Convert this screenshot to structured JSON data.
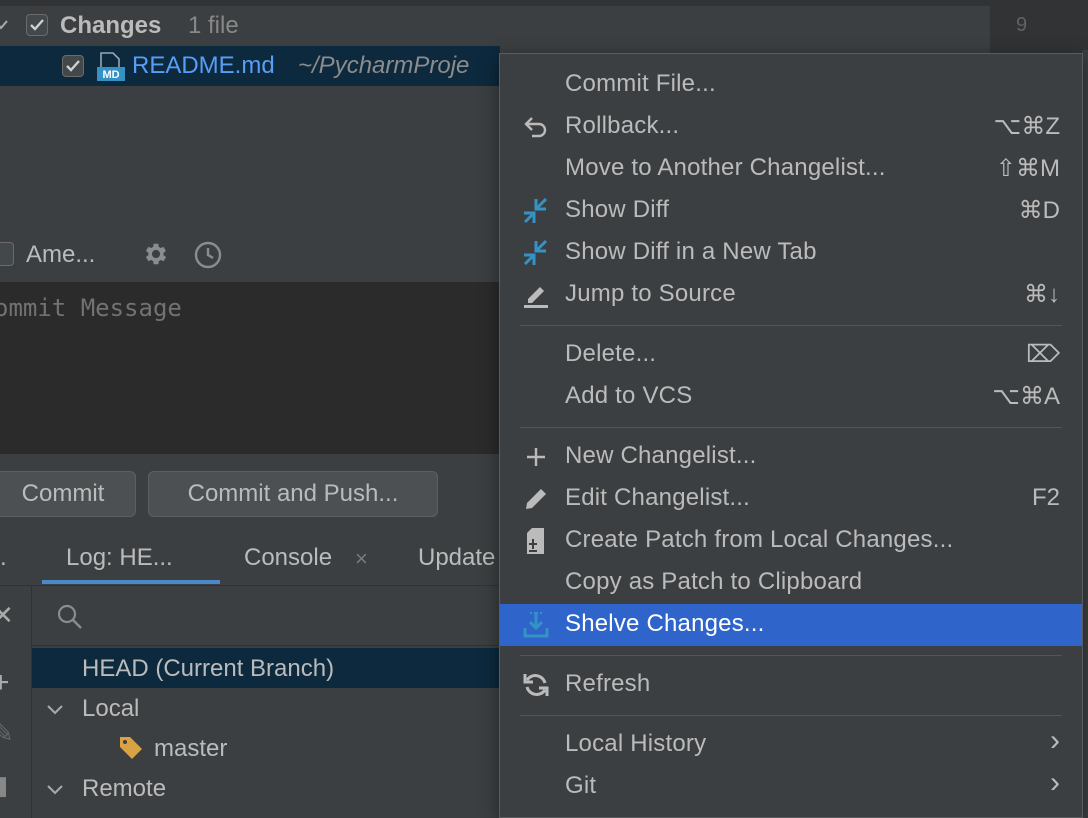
{
  "gutter": {
    "line_number": "9"
  },
  "changes_tree": {
    "group_label": "Changes",
    "group_count": "1 file",
    "file": {
      "name": "README.md",
      "path": "~/PycharmProje",
      "type_badge": "MD"
    }
  },
  "commit_panel": {
    "amend_label": "Ame...",
    "message_placeholder": "ommit Message",
    "commit_button": "Commit",
    "commit_push_button": "Commit and Push..."
  },
  "tool_window": {
    "tabs": [
      {
        "label": "."
      },
      {
        "label": "Log: HE..."
      },
      {
        "label": "Console"
      },
      {
        "label": "Update"
      }
    ],
    "console_close": "×",
    "branches": {
      "head": "HEAD (Current Branch)",
      "local": "Local",
      "local_branch": "master",
      "remote": "Remote"
    }
  },
  "context_menu": {
    "items": [
      {
        "label": "Commit File...",
        "shortcut": "",
        "icon": "none"
      },
      {
        "label": "Rollback...",
        "shortcut": "⌥⌘Z",
        "icon": "rollback-icon"
      },
      {
        "label": "Move to Another Changelist...",
        "shortcut": "⇧⌘M",
        "icon": "none"
      },
      {
        "label": "Show Diff",
        "shortcut": "⌘D",
        "icon": "diff-icon"
      },
      {
        "label": "Show Diff in a New Tab",
        "shortcut": "",
        "icon": "diff-icon"
      },
      {
        "label": "Jump to Source",
        "shortcut": "⌘↓",
        "icon": "edit-source-icon"
      },
      {
        "label": "Delete...",
        "shortcut": "⌦",
        "icon": "none"
      },
      {
        "label": "Add to VCS",
        "shortcut": "⌥⌘A",
        "icon": "none"
      },
      {
        "label": "New Changelist...",
        "shortcut": "",
        "icon": "plus-icon"
      },
      {
        "label": "Edit Changelist...",
        "shortcut": "F2",
        "icon": "pencil-icon"
      },
      {
        "label": "Create Patch from Local Changes...",
        "shortcut": "",
        "icon": "patch-icon"
      },
      {
        "label": "Copy as Patch to Clipboard",
        "shortcut": "",
        "icon": "none"
      },
      {
        "label": "Shelve Changes...",
        "shortcut": "",
        "icon": "shelve-icon",
        "selected": true
      },
      {
        "label": "Refresh",
        "shortcut": "",
        "icon": "refresh-icon"
      },
      {
        "label": "Local History",
        "shortcut": "›",
        "icon": "none"
      },
      {
        "label": "Git",
        "shortcut": "›",
        "icon": "none"
      }
    ]
  },
  "colors": {
    "background": "#3c3f41",
    "selection": "#2f65ca",
    "tree_selection": "#0d293e",
    "link_blue": "#589df6",
    "diff_icon_blue": "#3592c4",
    "tag_orange": "#d9a343"
  }
}
